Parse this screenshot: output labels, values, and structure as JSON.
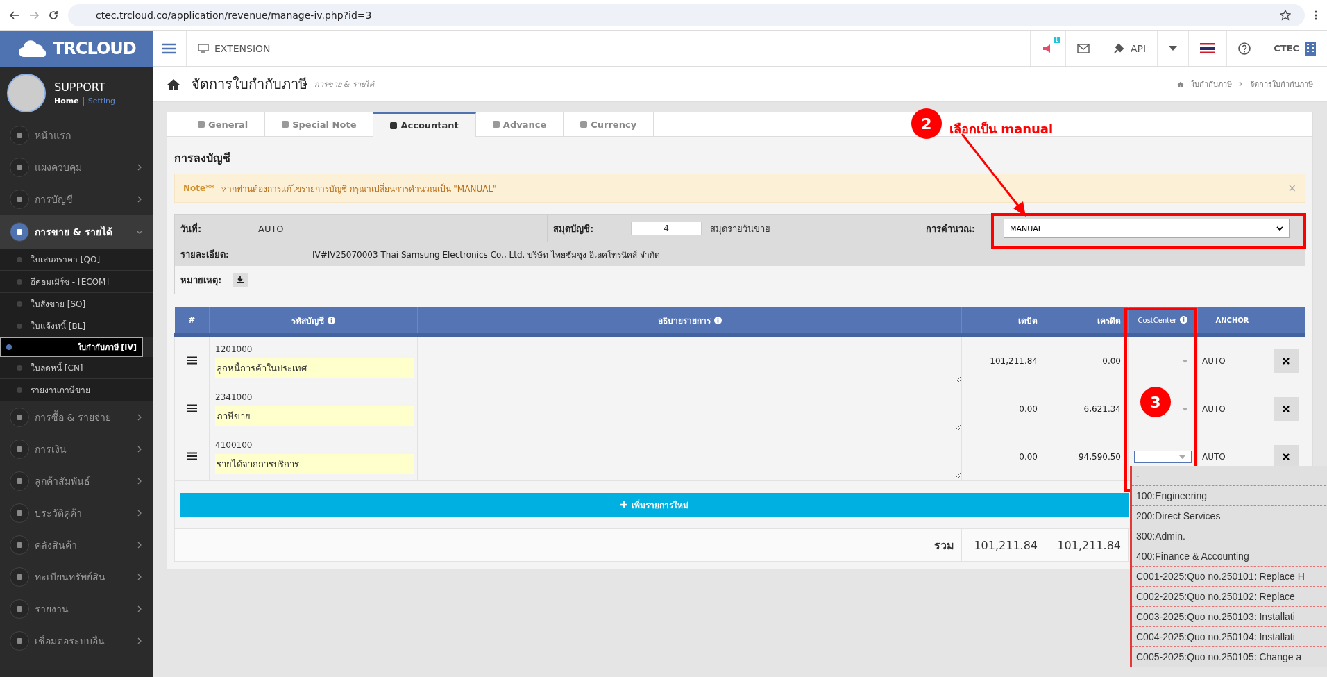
{
  "browser": {
    "url": "ctec.trcloud.co/application/revenue/manage-iv.php?id=3"
  },
  "header": {
    "logo": "TRCLOUD",
    "extension": "EXTENSION",
    "badge": "1",
    "api": "API",
    "user": "CTEC"
  },
  "sidebar": {
    "profile": {
      "name": "SUPPORT",
      "links": [
        "Home",
        "Setting"
      ]
    },
    "items": [
      {
        "label": "หน้าแรก",
        "expanded": false,
        "has_children": false
      },
      {
        "label": "แผงควบคุม",
        "expanded": false,
        "has_children": true
      },
      {
        "label": "การบัญชี",
        "expanded": false,
        "has_children": true
      },
      {
        "label": "การขาย & รายได้",
        "expanded": true,
        "has_children": true,
        "children": [
          {
            "label": "ใบเสนอราคา [QO]",
            "selected": false
          },
          {
            "label": "อีคอมเมิร์ซ - [ECOM]",
            "selected": false
          },
          {
            "label": "ใบสั่งขาย [SO]",
            "selected": false
          },
          {
            "label": "ใบแจ้งหนี้ [BL]",
            "selected": false
          },
          {
            "label": "ใบกำกับภาษี [IV]",
            "selected": true
          },
          {
            "label": "ใบลดหนี้ [CN]",
            "selected": false
          },
          {
            "label": "รายงานภาษีขาย",
            "selected": false
          }
        ]
      },
      {
        "label": "การซื้อ & รายจ่าย",
        "expanded": false,
        "has_children": true
      },
      {
        "label": "การเงิน",
        "expanded": false,
        "has_children": true
      },
      {
        "label": "ลูกค้าสัมพันธ์",
        "expanded": false,
        "has_children": true
      },
      {
        "label": "ประวัติคู่ค้า",
        "expanded": false,
        "has_children": true
      },
      {
        "label": "คลังสินค้า",
        "expanded": false,
        "has_children": true
      },
      {
        "label": "ทะเบียนทรัพย์สิน",
        "expanded": false,
        "has_children": true
      },
      {
        "label": "รายงาน",
        "expanded": false,
        "has_children": true
      },
      {
        "label": "เชื่อมต่อระบบอื่น",
        "expanded": false,
        "has_children": true
      }
    ]
  },
  "page": {
    "title": "จัดการใบกำกับภาษี",
    "subtitle": "การขาย & รายได้",
    "breadcrumbs": [
      "ใบกำกับภาษี",
      "จัดการใบกำกับภาษี"
    ]
  },
  "tabs": [
    {
      "label": "General",
      "selected": false
    },
    {
      "label": "Special Note",
      "selected": false
    },
    {
      "label": "Accountant",
      "selected": true
    },
    {
      "label": "Advance",
      "selected": false
    },
    {
      "label": "Currency",
      "selected": false
    }
  ],
  "section_title": "การลงบัญชี",
  "note": {
    "label": "Note**",
    "text": "หากท่านต้องการแก้ไขรายการบัญชี กรุณาเปลี่ยนการคำนวณเป็น \"MANUAL\"",
    "close": "×"
  },
  "form": {
    "date_label": "วันที่:",
    "date_value": "AUTO",
    "book_label": "สมุดบัญชี:",
    "book_value": "4",
    "book_name": "สมุดรายวันขาย",
    "calc_label": "การคำนวณ:",
    "calc_value": "MANUAL",
    "detail_label": "รายละเอียด:",
    "detail_value": "IV#IV25070003 Thai Samsung Electronics Co., Ltd. บริษัท ไทยซัมซุง อิเลคโทรนิคส์ จำกัด",
    "remark_label": "หมายเหตุ:"
  },
  "table": {
    "columns": [
      "#",
      "รหัสบัญชี",
      "อธิบายรายการ",
      "เดบิต",
      "เครดิต",
      "CostCenter",
      "ANCHOR"
    ],
    "rows": [
      {
        "code": "1201000",
        "name": "ลูกหนี้การค้าในประเทศ",
        "debit": "101,211.84",
        "credit": "0.00",
        "anchor": "AUTO",
        "cost_center_open": false
      },
      {
        "code": "2341000",
        "name": "ภาษีขาย",
        "debit": "0.00",
        "credit": "6,621.34",
        "anchor": "AUTO",
        "cost_center_open": false
      },
      {
        "code": "4100100",
        "name": "รายได้จากการบริการ",
        "debit": "0.00",
        "credit": "94,590.50",
        "anchor": "AUTO",
        "cost_center_open": true
      }
    ],
    "add_button": "เพิ่มรายการใหม่",
    "total_label": "รวม",
    "total_debit": "101,211.84",
    "total_credit": "101,211.84"
  },
  "cost_center_options": [
    "-",
    "100:Engineering",
    "200:Direct Services",
    "300:Admin.",
    "400:Finance & Accounting",
    "C001-2025:Quo no.250101: Replace H",
    "C002-2025:Quo no.250102: Replace",
    "C003-2025:Quo no.250103: Installati",
    "C004-2025:Quo no.250104: Installati",
    "C005-2025:Quo no.250105: Change a"
  ],
  "annotations": [
    {
      "number": "2",
      "text": "เลือกเป็น manual"
    },
    {
      "number": "3"
    }
  ]
}
